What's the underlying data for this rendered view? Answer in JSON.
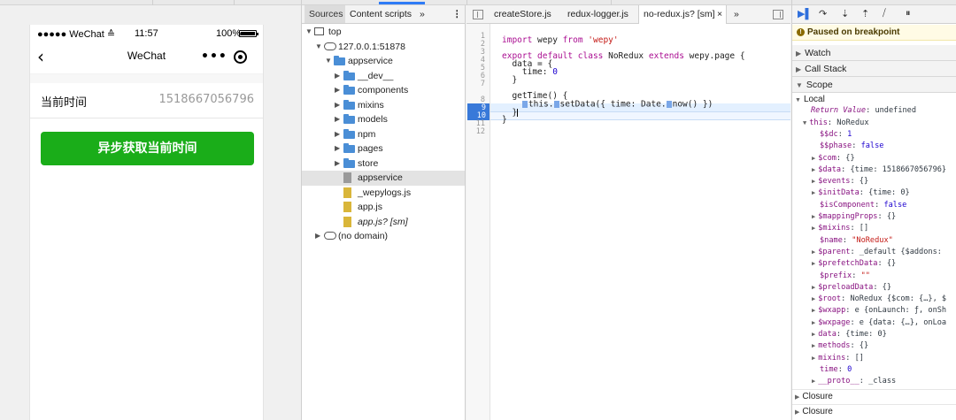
{
  "simulator": {
    "status": {
      "carrier": "●●●●● WeChat",
      "wifi": "≙",
      "time": "11:57",
      "battery": "100%"
    },
    "nav": {
      "back": "‹",
      "title": "WeChat",
      "more": "•••"
    },
    "row": {
      "label": "当前时间",
      "value": "1518667056796"
    },
    "button": {
      "label": "异步获取当前时间"
    }
  },
  "navigator": {
    "tabs": [
      "Sources",
      "Content scripts",
      "»"
    ],
    "tree": [
      {
        "label": "top",
        "type": "frame",
        "arrow": "▼"
      },
      {
        "label": "127.0.0.1:51878",
        "type": "cloud",
        "arrow": "▼"
      },
      {
        "label": "appservice",
        "type": "folder",
        "arrow": "▼"
      },
      {
        "label": "__dev__",
        "type": "folder",
        "arrow": "▶"
      },
      {
        "label": "components",
        "type": "folder",
        "arrow": "▶"
      },
      {
        "label": "mixins",
        "type": "folder",
        "arrow": "▶"
      },
      {
        "label": "models",
        "type": "folder",
        "arrow": "▶"
      },
      {
        "label": "npm",
        "type": "folder",
        "arrow": "▶"
      },
      {
        "label": "pages",
        "type": "folder",
        "arrow": "▶"
      },
      {
        "label": "store",
        "type": "folder",
        "arrow": "▶"
      },
      {
        "label": "appservice",
        "type": "file-grey",
        "arrow": ""
      },
      {
        "label": "_wepylogs.js",
        "type": "file",
        "arrow": ""
      },
      {
        "label": "app.js",
        "type": "file",
        "arrow": ""
      },
      {
        "label": "app.js? [sm]",
        "type": "file-italic",
        "arrow": ""
      },
      {
        "label": "(no domain)",
        "type": "cloud",
        "arrow": "▶"
      }
    ]
  },
  "editor": {
    "tabs": [
      "createStore.js",
      "redux-logger.js",
      "no-redux.js? [sm]",
      "×",
      "»"
    ],
    "lines": [
      {
        "n": "1",
        "text": ""
      },
      {
        "n": "2",
        "text": "import wepy from 'wepy'"
      },
      {
        "n": "3",
        "text": ""
      },
      {
        "n": "4",
        "text": "export default class NoRedux extends wepy.page {"
      },
      {
        "n": "5",
        "text": "  data = {"
      },
      {
        "n": "6",
        "text": "    time: 0"
      },
      {
        "n": "7",
        "text": "  }"
      },
      {
        "n": "8",
        "text": "  getTime() {"
      },
      {
        "n": "9",
        "text": "    this.setData({ time: Date.now() })"
      },
      {
        "n": "10",
        "text": "  }"
      },
      {
        "n": "11",
        "text": "}"
      },
      {
        "n": "12",
        "text": ""
      }
    ]
  },
  "debugger": {
    "toolbar": [
      "resume-icon",
      "step-over-icon",
      "step-into-icon",
      "step-out-icon",
      "deactivate-breakpoints-icon",
      "pause-exceptions-icon"
    ],
    "paused": "Paused on breakpoint",
    "sections": [
      "Watch",
      "Call Stack",
      "Scope"
    ],
    "local": "Local",
    "scope": [
      {
        "indent": 0,
        "arrow": "",
        "key": "Return Value",
        "sep": ": ",
        "val": "undefined",
        "italic": true
      },
      {
        "indent": 0,
        "arrow": "▼",
        "key": "this",
        "sep": ": ",
        "val": "NoRedux"
      },
      {
        "indent": 1,
        "arrow": "",
        "key": "$$dc",
        "sep": ": ",
        "val": "1",
        "num": true
      },
      {
        "indent": 1,
        "arrow": "",
        "key": "$$phase",
        "sep": ": ",
        "val": "false",
        "num": true
      },
      {
        "indent": 1,
        "arrow": "▶",
        "key": "$com",
        "sep": ": ",
        "val": "{}"
      },
      {
        "indent": 1,
        "arrow": "▶",
        "key": "$data",
        "sep": ": ",
        "val": "{time: 1518667056796}"
      },
      {
        "indent": 1,
        "arrow": "▶",
        "key": "$events",
        "sep": ": ",
        "val": "{}"
      },
      {
        "indent": 1,
        "arrow": "▶",
        "key": "$initData",
        "sep": ": ",
        "val": "{time: 0}"
      },
      {
        "indent": 1,
        "arrow": "",
        "key": "$isComponent",
        "sep": ": ",
        "val": "false",
        "num": true
      },
      {
        "indent": 1,
        "arrow": "▶",
        "key": "$mappingProps",
        "sep": ": ",
        "val": "{}"
      },
      {
        "indent": 1,
        "arrow": "▶",
        "key": "$mixins",
        "sep": ": ",
        "val": "[]"
      },
      {
        "indent": 1,
        "arrow": "",
        "key": "$name",
        "sep": ": ",
        "val": "\"NoRedux\"",
        "str": true
      },
      {
        "indent": 1,
        "arrow": "▶",
        "key": "$parent",
        "sep": ": ",
        "val": "_default {$addons:"
      },
      {
        "indent": 1,
        "arrow": "▶",
        "key": "$prefetchData",
        "sep": ": ",
        "val": "{}"
      },
      {
        "indent": 1,
        "arrow": "",
        "key": "$prefix",
        "sep": ": ",
        "val": "\"\"",
        "str": true
      },
      {
        "indent": 1,
        "arrow": "▶",
        "key": "$preloadData",
        "sep": ": ",
        "val": "{}"
      },
      {
        "indent": 1,
        "arrow": "▶",
        "key": "$root",
        "sep": ": ",
        "val": "NoRedux {$com: {…}, $"
      },
      {
        "indent": 1,
        "arrow": "▶",
        "key": "$wxapp",
        "sep": ": ",
        "val": "e {onLaunch: ƒ, onSh"
      },
      {
        "indent": 1,
        "arrow": "▶",
        "key": "$wxpage",
        "sep": ": ",
        "val": "e {data: {…}, onLoa"
      },
      {
        "indent": 1,
        "arrow": "▶",
        "key": "data",
        "sep": ": ",
        "val": "{time: 0}"
      },
      {
        "indent": 1,
        "arrow": "▶",
        "key": "methods",
        "sep": ": ",
        "val": "{}"
      },
      {
        "indent": 1,
        "arrow": "▶",
        "key": "mixins",
        "sep": ": ",
        "val": "[]"
      },
      {
        "indent": 1,
        "arrow": "",
        "key": "time",
        "sep": ": ",
        "val": "0",
        "num": true
      },
      {
        "indent": 1,
        "arrow": "▶",
        "key": "__proto__",
        "sep": ": ",
        "val": "_class"
      }
    ],
    "closures": [
      "Closure",
      "Closure"
    ]
  }
}
